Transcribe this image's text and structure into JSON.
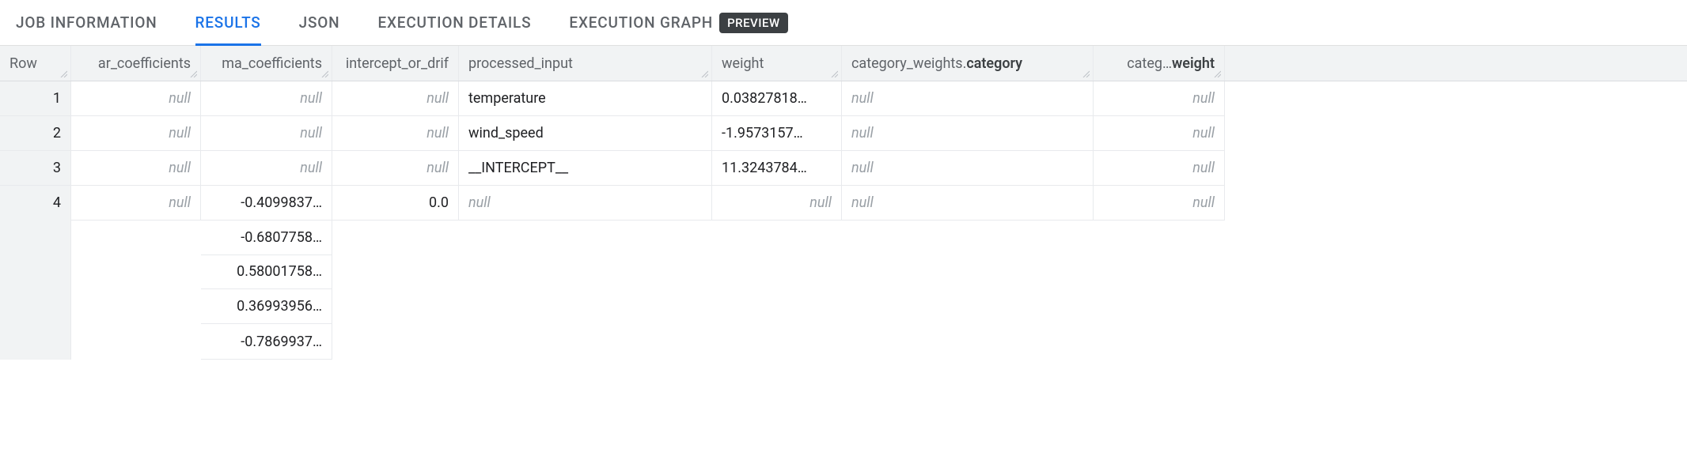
{
  "tabs": {
    "job_info": "JOB INFORMATION",
    "results": "RESULTS",
    "json": "JSON",
    "exec_details": "EXECUTION DETAILS",
    "exec_graph": "EXECUTION GRAPH",
    "preview_badge": "PREVIEW"
  },
  "null_label": "null",
  "headers": {
    "row": "Row",
    "ar": "ar_coefficients",
    "ma": "ma_coefficients",
    "intercept": "intercept_or_drif",
    "processed_input": "processed_input",
    "weight": "weight",
    "category": "category_weights.",
    "category_bold": "category",
    "cw_prefix": "categ…",
    "cw_bold": "weight"
  },
  "rows": [
    {
      "row": "1",
      "ar": null,
      "ma": null,
      "intercept": null,
      "processed_input": "temperature",
      "weight": "0.03827818…",
      "category": null,
      "cat_weight": null
    },
    {
      "row": "2",
      "ar": null,
      "ma": null,
      "intercept": null,
      "processed_input": "wind_speed",
      "weight": "-1.9573157…",
      "category": null,
      "cat_weight": null
    },
    {
      "row": "3",
      "ar": null,
      "ma": null,
      "intercept": null,
      "processed_input": "__INTERCEPT__",
      "weight": "11.3243784…",
      "category": null,
      "cat_weight": null
    },
    {
      "row": "4",
      "ar": null,
      "ma_list": [
        "-0.4099837…",
        "-0.6807758…",
        "0.58001758…",
        "0.36993956…",
        "-0.7869937…"
      ],
      "intercept": "0.0",
      "processed_input": null,
      "weight": null,
      "category": null,
      "cat_weight": null
    }
  ]
}
